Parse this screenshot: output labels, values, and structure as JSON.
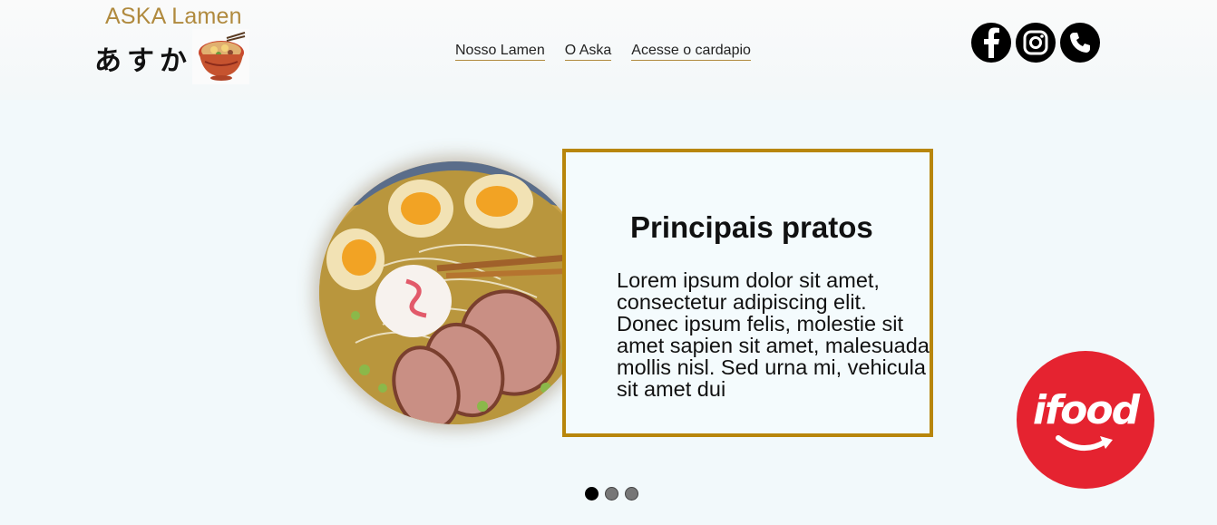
{
  "brand": {
    "title": "ASKA Lamen",
    "kana": "あすか"
  },
  "nav": {
    "items": [
      "Nosso Lamen",
      "O Aska",
      "Acesse o cardapio"
    ]
  },
  "social": {
    "icons": [
      "facebook-icon",
      "instagram-icon",
      "phone-icon"
    ]
  },
  "featured": {
    "heading": "Principais pratos",
    "body": "Lorem ipsum dolor sit amet, consectetur adipiscing elit. Donec ipsum felis, molestie sit amet sapien sit amet, malesuada mollis nisl. Sed urna mi, vehicula sit amet dui"
  },
  "carousel": {
    "slide_count": 3,
    "active_index": 0
  },
  "ifood": {
    "label": "ifood"
  },
  "colors": {
    "accent": "#b8860b",
    "brand_title": "#b08a3e",
    "ifood_red": "#e52330",
    "background": "#f2f9fb"
  }
}
